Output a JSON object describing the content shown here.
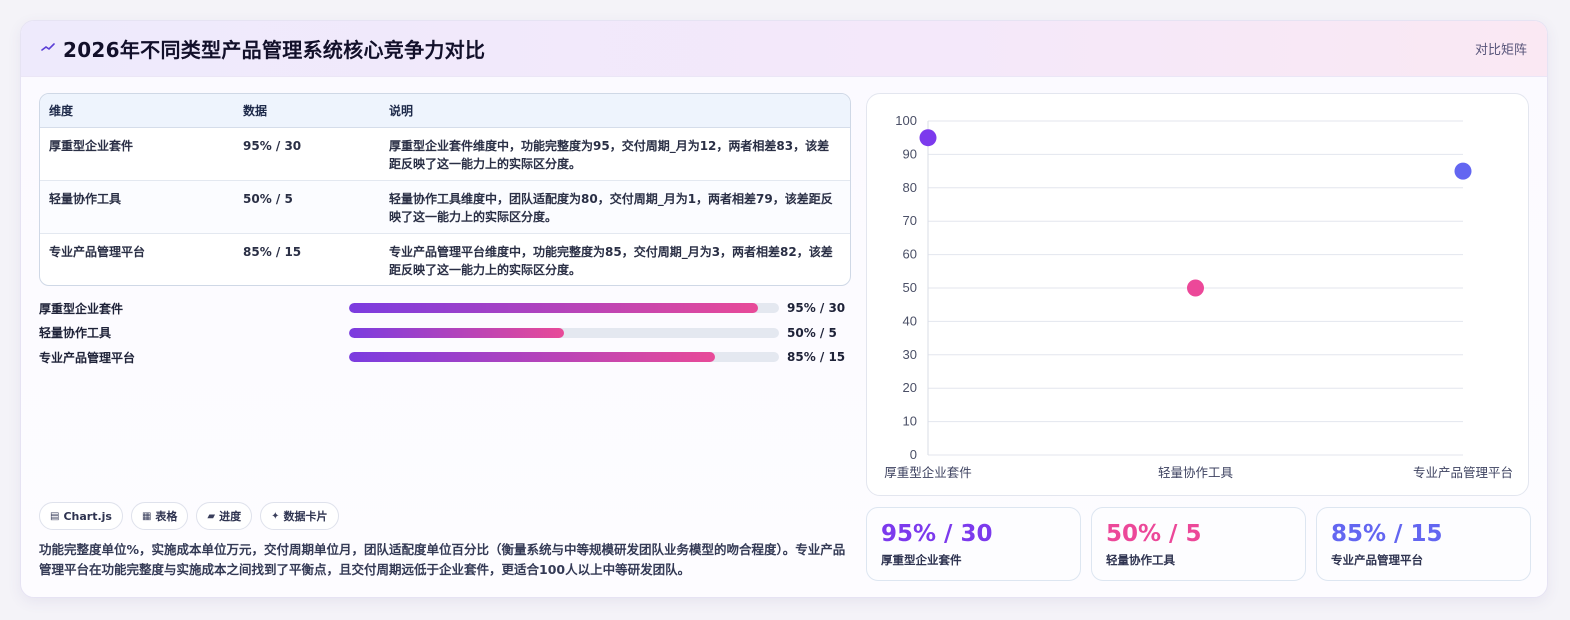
{
  "header": {
    "title": "2026年不同类型产品管理系统核心竞争力对比",
    "icon": "trend-line-icon",
    "right_link": "对比矩阵"
  },
  "table": {
    "columns": [
      "维度",
      "数据",
      "说明"
    ],
    "rows": [
      {
        "dimension": "厚重型企业套件",
        "data": "95% / 30",
        "desc": "厚重型企业套件维度中，功能完整度为95，交付周期_月为12，两者相差83，该差距反映了这一能力上的实际区分度。"
      },
      {
        "dimension": "轻量协作工具",
        "data": "50% / 5",
        "desc": "轻量协作工具维度中，团队适配度为80，交付周期_月为1，两者相差79，该差距反映了这一能力上的实际区分度。"
      },
      {
        "dimension": "专业产品管理平台",
        "data": "85% / 15",
        "desc": "专业产品管理平台维度中，功能完整度为85，交付周期_月为3，两者相差82，该差距反映了这一能力上的实际区分度。"
      }
    ]
  },
  "progress": [
    {
      "label": "厚重型企业套件",
      "percent": 95,
      "value": "95% / 30"
    },
    {
      "label": "轻量协作工具",
      "percent": 50,
      "value": "50% / 5"
    },
    {
      "label": "专业产品管理平台",
      "percent": 85,
      "value": "85% / 15"
    }
  ],
  "tags": [
    {
      "icon": "chart-icon",
      "glyph": "▤",
      "label": "Chart.js"
    },
    {
      "icon": "table-icon",
      "glyph": "▦",
      "label": "表格"
    },
    {
      "icon": "progress-icon",
      "glyph": "▰",
      "label": "进度"
    },
    {
      "icon": "sparkle-icon",
      "glyph": "✦",
      "label": "数据卡片"
    }
  ],
  "note": "功能完整度单位%，实施成本单位万元，交付周期单位月，团队适配度单位百分比（衡量系统与中等规模研发团队业务模型的吻合程度）。专业产品管理平台在功能完整度与实施成本之间找到了平衡点，且交付周期远低于企业套件，更适合100人以上中等研发团队。",
  "chart_data": {
    "type": "scatter",
    "categories": [
      "厚重型企业套件",
      "轻量协作工具",
      "专业产品管理平台"
    ],
    "values": [
      95,
      50,
      85
    ],
    "point_colors": [
      "#7c3aed",
      "#ec4899",
      "#6366f1"
    ],
    "ylim": [
      0,
      100
    ],
    "yticks": [
      0,
      10,
      20,
      30,
      40,
      50,
      60,
      70,
      80,
      90,
      100
    ],
    "grid": true,
    "legend": "none"
  },
  "stats": [
    {
      "value": "95% / 30",
      "label": "厚重型企业套件",
      "color": "#7c3aed"
    },
    {
      "value": "50% / 5",
      "label": "轻量协作工具",
      "color": "#ec4899"
    },
    {
      "value": "85% / 15",
      "label": "专业产品管理平台",
      "color": "#6366f1"
    }
  ]
}
